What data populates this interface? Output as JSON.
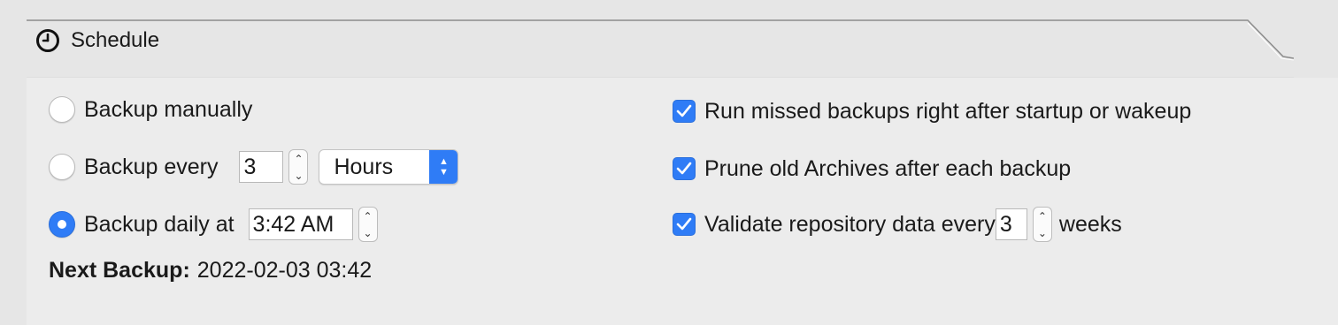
{
  "tab": {
    "title": "Schedule",
    "icon": "clock-icon"
  },
  "schedule": {
    "manual": {
      "label": "Backup manually",
      "selected": false
    },
    "every": {
      "label": "Backup every",
      "value": "3",
      "unit": "Hours",
      "selected": false
    },
    "daily": {
      "label": "Backup daily at",
      "time": "3:42 AM",
      "selected": true
    },
    "next": {
      "label": "Next Backup:",
      "value": "2022-02-03 03:42"
    }
  },
  "options": {
    "missed": {
      "label": "Run missed backups right after startup or wakeup",
      "checked": true
    },
    "prune": {
      "label": "Prune old Archives after each backup",
      "checked": true
    },
    "validate": {
      "label": "Validate repository data every",
      "value": "3",
      "unit": "weeks",
      "checked": true
    }
  },
  "colors": {
    "accent": "#2f7cf6",
    "panel": "#ececec",
    "background": "#e6e6e6"
  }
}
